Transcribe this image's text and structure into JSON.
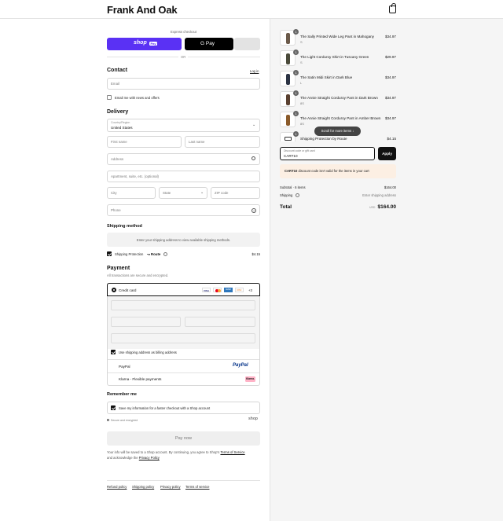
{
  "brand": "Frank And Oak",
  "express": {
    "title": "Express checkout",
    "shop_pay": "shop",
    "shop_pay_badge": "Pay",
    "google_pay": "G Pay",
    "or": "OR"
  },
  "contact": {
    "title": "Contact",
    "login": "Log in",
    "email_placeholder": "Email",
    "newsletter": "Email me with news and offers"
  },
  "delivery": {
    "title": "Delivery",
    "country_label": "Country/Region",
    "country_value": "United States",
    "first_name": "First name",
    "last_name": "Last name",
    "address": "Address",
    "apartment": "Apartment, suite, etc. (optional)",
    "city": "City",
    "state": "State",
    "zip": "ZIP code",
    "phone": "Phone"
  },
  "shipping": {
    "title": "Shipping method",
    "note": "Enter your shipping address to view available shipping methods.",
    "protection_label": "Shipping Protection",
    "route": "Route",
    "protection_price": "$4.15"
  },
  "payment": {
    "title": "Payment",
    "subtitle": "All transactions are secure and encrypted.",
    "credit_card": "Credit card",
    "card_brands": [
      "VISA",
      "MC",
      "AMEX",
      "DISC"
    ],
    "more_cards": "+3",
    "billing_same": "Use shipping address as billing address",
    "paypal": "PayPal",
    "paypal_logo": "PayPal",
    "klarna": "Klarna - Flexible payments",
    "klarna_logo": "Klarna."
  },
  "remember": {
    "title": "Remember me",
    "save_info": "Save my information for a faster checkout with a Shop account",
    "secure": "Secure and encrypted",
    "shop_logo": "shop"
  },
  "pay_now": "Pay now",
  "disclaimer_1": "Your info will be saved to a Shop account. By continuing, you agree to Shop's",
  "disclaimer_terms": "Terms of Service",
  "disclaimer_2": "and acknowledge the",
  "disclaimer_privacy": "Privacy Policy",
  "footer_links": [
    "Refund policy",
    "Shipping policy",
    "Privacy policy",
    "Terms of service"
  ],
  "cart": {
    "items": [
      {
        "name": "The Sally Printed Wide Leg Pant in Mahogany",
        "size": "S",
        "price": "$34.97",
        "qty": "1"
      },
      {
        "name": "The Light Corduroy Shirt in Tuscany Green",
        "size": "S",
        "price": "$29.97",
        "qty": "1"
      },
      {
        "name": "The Satin Midi Skirt in Dark Blue",
        "size": "L",
        "price": "$34.97",
        "qty": "1"
      },
      {
        "name": "The Annie Straight Corduroy Pant in Dark Brown",
        "size": "8S",
        "price": "$34.97",
        "qty": "1"
      },
      {
        "name": "The Annie Straight Corduroy Pant in Amber Brown",
        "size": "8S",
        "price": "$34.97",
        "qty": "1"
      }
    ],
    "protection_item": "Shipping Protection by Route",
    "protection_price": "$4.15",
    "protection_qty": "1",
    "scroll_hint": "Scroll for more items",
    "discount_label": "Discount code or gift card",
    "discount_value": "CART10",
    "apply": "Apply",
    "discount_error_code": "CART10",
    "discount_error": "discount code isn't valid for the items in your cart",
    "subtotal_label": "Subtotal · 6 items",
    "subtotal_value": "$164.00",
    "shipping_label": "Shipping",
    "shipping_value": "Enter shipping address",
    "total_label": "Total",
    "currency": "USD",
    "total_value": "$164.00"
  }
}
